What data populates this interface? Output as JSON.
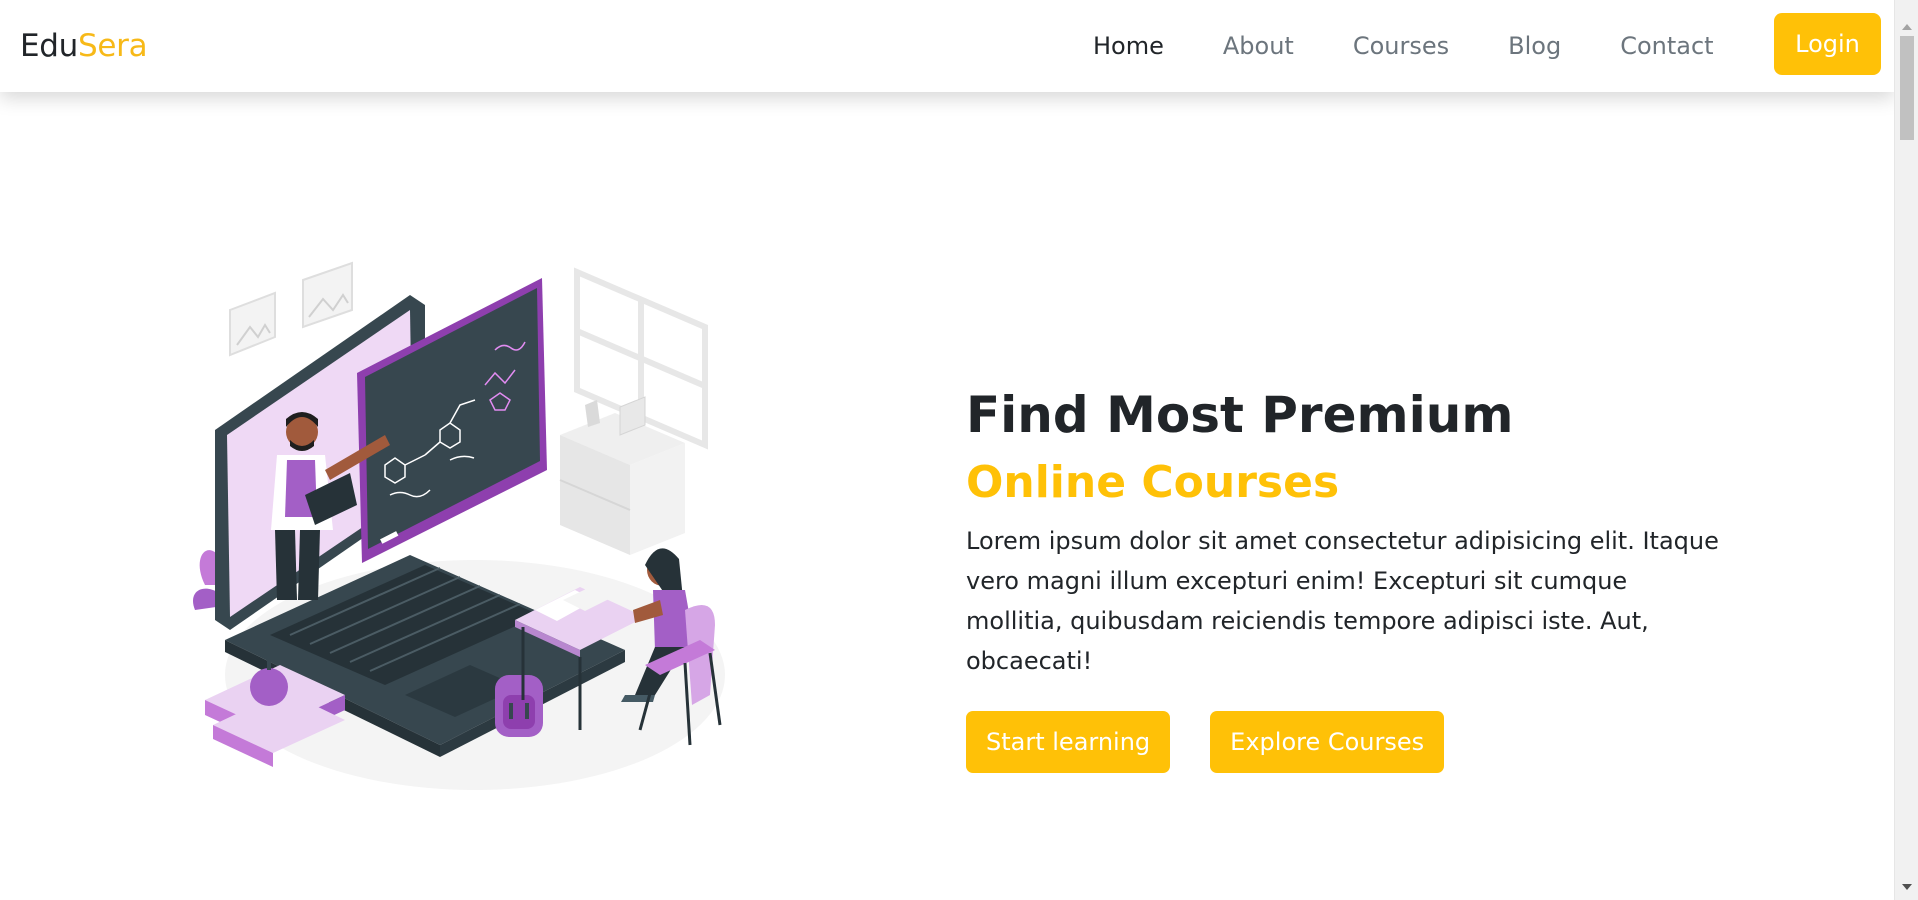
{
  "brand": {
    "part1": "Edu",
    "part2": "Sera"
  },
  "nav": {
    "items": [
      {
        "label": "Home",
        "active": true
      },
      {
        "label": "About",
        "active": false
      },
      {
        "label": "Courses",
        "active": false
      },
      {
        "label": "Blog",
        "active": false
      },
      {
        "label": "Contact",
        "active": false
      }
    ],
    "login_label": "Login"
  },
  "hero": {
    "title": "Find Most Premium",
    "subtitle": "Online Courses",
    "lead": "Lorem ipsum dolor sit amet consectetur adipisicing elit. Itaque vero magni illum excepturi enim! Excepturi sit cumque mollitia, quibusdam reiciendis tempore adipisci iste. Aut, obcaecati!",
    "primary_button": "Start learning",
    "secondary_button": "Explore Courses"
  },
  "colors": {
    "accent": "#ffc107",
    "brand_accent": "#f7b918",
    "illustration_purple": "#a35fc6"
  }
}
